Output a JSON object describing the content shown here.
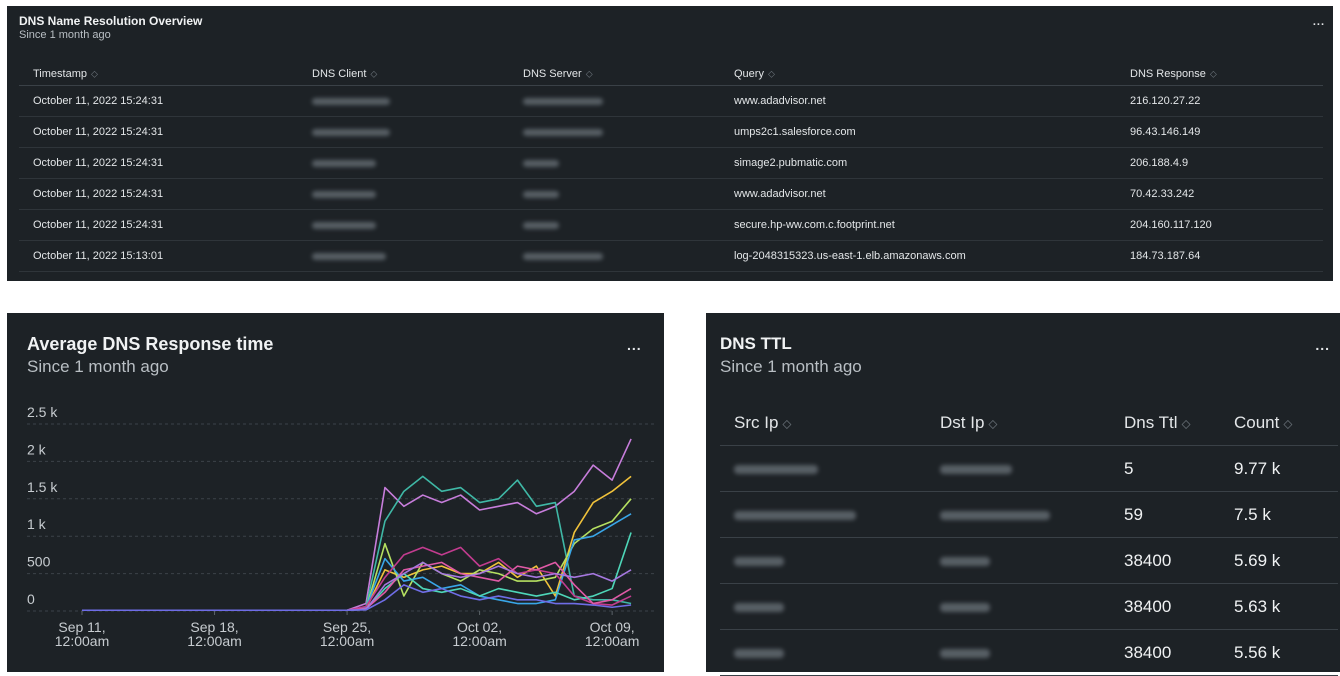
{
  "dns_overview": {
    "title": "DNS Name Resolution Overview",
    "subtitle": "Since 1 month ago",
    "menu": "...",
    "columns": [
      "Timestamp",
      "DNS Client",
      "DNS Server",
      "Query",
      "DNS Response"
    ],
    "rows": [
      {
        "timestamp": "October 11, 2022 15:24:31",
        "query": "www.adadvisor.net",
        "response": "216.120.27.22"
      },
      {
        "timestamp": "October 11, 2022 15:24:31",
        "query": "umps2c1.salesforce.com",
        "response": "96.43.146.149"
      },
      {
        "timestamp": "October 11, 2022 15:24:31",
        "query": "simage2.pubmatic.com",
        "response": "206.188.4.9"
      },
      {
        "timestamp": "October 11, 2022 15:24:31",
        "query": "www.adadvisor.net",
        "response": "70.42.33.242"
      },
      {
        "timestamp": "October 11, 2022 15:24:31",
        "query": "secure.hp-ww.com.c.footprint.net",
        "response": "204.160.117.120"
      },
      {
        "timestamp": "October 11, 2022 15:13:01",
        "query": "log-2048315323.us-east-1.elb.amazonaws.com",
        "response": "184.73.187.64"
      }
    ]
  },
  "response_time": {
    "title": "Average DNS Response time",
    "subtitle": "Since 1 month ago",
    "menu": "..."
  },
  "chart_data": {
    "type": "line",
    "ylim": [
      0,
      2500
    ],
    "y_ticks": [
      "2.5 k",
      "2 k",
      "1.5 k",
      "1 k",
      "500",
      "0"
    ],
    "y_tick_values": [
      2500,
      2000,
      1500,
      1000,
      500,
      0
    ],
    "x_ticks": [
      {
        "day": 0,
        "line1": "Sep 11,",
        "line2": "12:00am"
      },
      {
        "day": 7,
        "line1": "Sep 18,",
        "line2": "12:00am"
      },
      {
        "day": 14,
        "line1": "Sep 25,",
        "line2": "12:00am"
      },
      {
        "day": 21,
        "line1": "Oct 02,",
        "line2": "12:00am"
      },
      {
        "day": 28,
        "line1": "Oct 09,",
        "line2": "12:00am"
      }
    ],
    "x": [
      0,
      1,
      2,
      3,
      4,
      5,
      6,
      7,
      8,
      9,
      10,
      11,
      12,
      13,
      14,
      15,
      16,
      17,
      18,
      19,
      20,
      21,
      22,
      23,
      24,
      25,
      26,
      27,
      28,
      29,
      30
    ],
    "grid": true,
    "legend": "none",
    "series": [
      {
        "color": "#c77ddb",
        "values": [
          10,
          10,
          10,
          10,
          10,
          10,
          10,
          10,
          10,
          10,
          10,
          10,
          10,
          10,
          10,
          100,
          1650,
          1400,
          1550,
          1450,
          1550,
          1350,
          1400,
          1450,
          1300,
          1400,
          1600,
          1950,
          1750,
          2300
        ]
      },
      {
        "color": "#3fb8a6",
        "values": [
          10,
          10,
          10,
          10,
          10,
          10,
          10,
          10,
          10,
          10,
          10,
          10,
          10,
          10,
          10,
          50,
          1200,
          1600,
          1800,
          1600,
          1650,
          1450,
          1500,
          1750,
          1400,
          1450,
          200,
          150,
          150,
          100
        ]
      },
      {
        "color": "#f0c23b",
        "values": [
          10,
          10,
          10,
          10,
          10,
          10,
          10,
          10,
          10,
          10,
          10,
          10,
          10,
          10,
          10,
          30,
          550,
          450,
          550,
          600,
          500,
          500,
          650,
          450,
          600,
          200,
          1050,
          1450,
          1600,
          1800
        ]
      },
      {
        "color": "#b5e061",
        "values": [
          10,
          10,
          10,
          10,
          10,
          10,
          10,
          10,
          10,
          10,
          10,
          10,
          10,
          10,
          10,
          20,
          900,
          200,
          650,
          500,
          400,
          550,
          500,
          400,
          400,
          450,
          900,
          1100,
          1200,
          1500
        ]
      },
      {
        "color": "#39a6e8",
        "values": [
          10,
          10,
          10,
          10,
          10,
          10,
          10,
          10,
          10,
          10,
          10,
          10,
          10,
          10,
          10,
          40,
          700,
          400,
          450,
          300,
          350,
          200,
          150,
          100,
          100,
          150,
          950,
          1000,
          1150,
          1300
        ]
      },
      {
        "color": "#4ed6b8",
        "values": [
          10,
          10,
          10,
          10,
          10,
          10,
          10,
          10,
          10,
          10,
          10,
          10,
          10,
          10,
          10,
          20,
          300,
          500,
          300,
          250,
          300,
          200,
          300,
          250,
          200,
          250,
          150,
          200,
          300,
          1050
        ]
      },
      {
        "color": "#c23c8f",
        "values": [
          10,
          10,
          10,
          10,
          10,
          10,
          10,
          10,
          10,
          10,
          10,
          10,
          10,
          10,
          10,
          60,
          450,
          750,
          850,
          750,
          850,
          600,
          700,
          500,
          550,
          500,
          200,
          100,
          80,
          200
        ]
      },
      {
        "color": "#e05aa6",
        "values": [
          10,
          10,
          10,
          10,
          10,
          10,
          10,
          10,
          10,
          10,
          10,
          10,
          10,
          10,
          10,
          30,
          250,
          550,
          600,
          650,
          500,
          450,
          400,
          600,
          550,
          650,
          350,
          100,
          150,
          300
        ]
      },
      {
        "color": "#a678e0",
        "values": [
          10,
          10,
          10,
          10,
          10,
          10,
          10,
          10,
          10,
          10,
          10,
          10,
          10,
          10,
          10,
          20,
          350,
          500,
          650,
          500,
          450,
          500,
          600,
          500,
          450,
          500,
          450,
          500,
          400,
          550
        ]
      },
      {
        "color": "#6f6de6",
        "values": [
          10,
          10,
          10,
          10,
          10,
          10,
          10,
          10,
          10,
          10,
          10,
          10,
          10,
          10,
          10,
          15,
          150,
          350,
          250,
          300,
          200,
          150,
          200,
          150,
          150,
          100,
          100,
          80,
          50,
          80
        ]
      }
    ]
  },
  "dns_ttl": {
    "title": "DNS TTL",
    "subtitle": "Since 1 month ago",
    "menu": "...",
    "columns": [
      "Src Ip",
      "Dst Ip",
      "Dns Ttl",
      "Count"
    ],
    "rows": [
      {
        "ttl": "5",
        "count": "9.77 k"
      },
      {
        "ttl": "59",
        "count": "7.5 k"
      },
      {
        "ttl": "38400",
        "count": "5.69 k"
      },
      {
        "ttl": "38400",
        "count": "5.63 k"
      },
      {
        "ttl": "38400",
        "count": "5.56 k"
      }
    ]
  }
}
